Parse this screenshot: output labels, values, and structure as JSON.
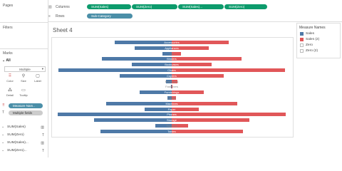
{
  "sections": {
    "pages": "Pages",
    "filters": "Filters",
    "marks": "Marks"
  },
  "shelves": {
    "columns_label": "Columns",
    "columns_pills": [
      "SUM(Sales)",
      "SUM(Zero)",
      "SUM(Sales)...",
      "SUM(Zero)"
    ],
    "rows_label": "Rows",
    "rows_pills": [
      "Sub-Category"
    ]
  },
  "marks": {
    "all_label": "All",
    "mark_type": "Multiple",
    "buttons": [
      "Color",
      "Size",
      "Label",
      "Detail",
      "Tooltip"
    ],
    "pills": [
      "Measure Nam..",
      "Multiple fields"
    ],
    "fields": [
      "SUM(Sales)",
      "SUM(Zero)",
      "SUM(Sales)...",
      "SUM(Zero)..."
    ]
  },
  "sheet_title": "Sheet 4",
  "legend": {
    "title": "Measure Names",
    "items": [
      {
        "label": "Sales",
        "color": "#4e79a7"
      },
      {
        "label": "Sales (2)",
        "color": "#e15759"
      },
      {
        "label": "Zero",
        "color": "#ffffff"
      },
      {
        "label": "Zero (2)",
        "color": "#ffffff"
      }
    ]
  },
  "chart_data": {
    "type": "bar",
    "categories": [
      "Accessories",
      "Appliances",
      "Art",
      "Binders",
      "Bookcases",
      "Chairs",
      "Copiers",
      "Envelopes",
      "Fasteners",
      "Furnishings",
      "Labels",
      "Machines",
      "Paper",
      "Phones",
      "Storage",
      "Supplies",
      "Tables"
    ],
    "series": [
      {
        "name": "Sales",
        "color": "#4e79a7",
        "values": [
          165,
          108,
          27,
          203,
          115,
          328,
          150,
          16,
          3,
          92,
          12,
          189,
          79,
          330,
          224,
          47,
          207
        ]
      },
      {
        "name": "Sales (2)",
        "color": "#e15759",
        "values": [
          165,
          108,
          27,
          203,
          115,
          328,
          150,
          16,
          3,
          92,
          12,
          189,
          79,
          330,
          224,
          47,
          207
        ]
      }
    ]
  }
}
